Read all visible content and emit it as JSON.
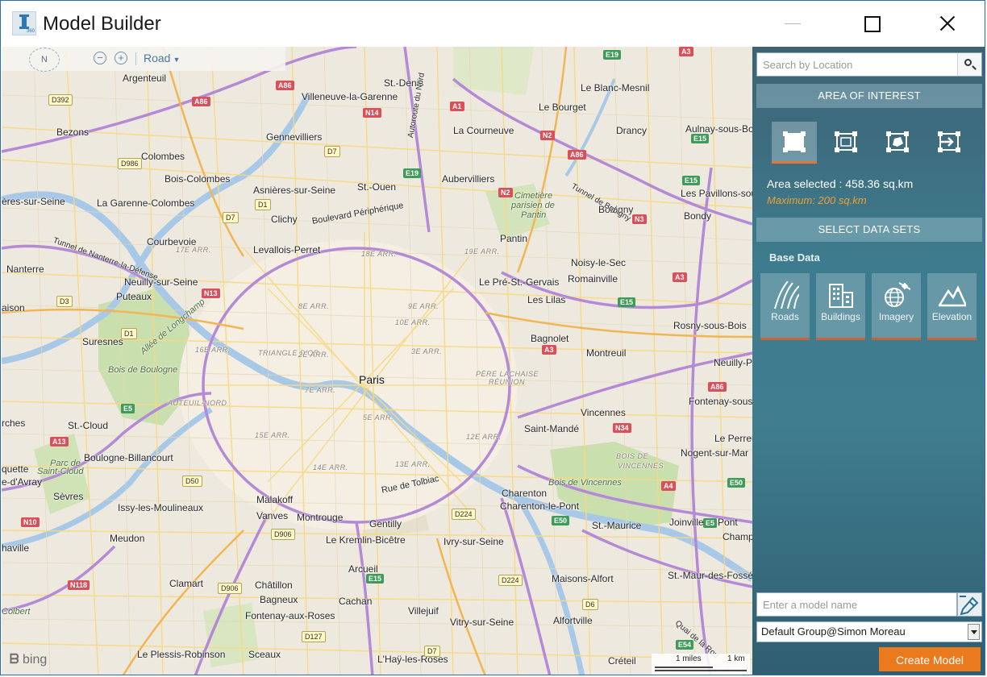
{
  "window": {
    "title": "Model Builder",
    "logo_sub": "360"
  },
  "map_toolbar": {
    "compass_label": "N",
    "zoom_out": "−",
    "zoom_in": "+",
    "map_style": "Road"
  },
  "map": {
    "labels": [
      {
        "text": "Paris",
        "cls": "big"
      },
      {
        "text": "Argenteuil"
      },
      {
        "text": "St.-Denis"
      },
      {
        "text": "Le Blanc-Mesnil"
      },
      {
        "text": "Villeneuve-la-Garenne"
      },
      {
        "text": "Le Bourget"
      },
      {
        "text": "Bezons"
      },
      {
        "text": "Gennevilliers"
      },
      {
        "text": "La Courneuve"
      },
      {
        "text": "Drancy"
      },
      {
        "text": "Aulnay-sous-Bo"
      },
      {
        "text": "Colombes"
      },
      {
        "text": "Bois-Colombes"
      },
      {
        "text": "Aubervilliers"
      },
      {
        "text": "Asnières-sur-Seine"
      },
      {
        "text": "St.-Ouen"
      },
      {
        "text": "Bobigny"
      },
      {
        "text": "Les Pavillons-sou"
      },
      {
        "text": "La Garenne-Colombes"
      },
      {
        "text": "ères-sur-Seine"
      },
      {
        "text": "Clichy"
      },
      {
        "text": "Bondy"
      },
      {
        "text": "Courbevoie"
      },
      {
        "text": "Levallois-Perret"
      },
      {
        "text": "Pantin"
      },
      {
        "text": "Noisy-le-Sec"
      },
      {
        "text": "Nanterre"
      },
      {
        "text": "Neuilly-sur-Seine"
      },
      {
        "text": "Le Pré-St.-Gervais"
      },
      {
        "text": "Romainville"
      },
      {
        "text": "Puteaux"
      },
      {
        "text": "Les Lilas"
      },
      {
        "text": "aison"
      },
      {
        "text": "Suresnes"
      },
      {
        "text": "Bagnolet"
      },
      {
        "text": "Rosny-sous-Bois"
      },
      {
        "text": "Montreuil"
      },
      {
        "text": "Neuilly-Pl"
      },
      {
        "text": "Fontenay-sous"
      },
      {
        "text": "rches"
      },
      {
        "text": "St.-Cloud"
      },
      {
        "text": "Vincennes"
      },
      {
        "text": "Saint-Mandé"
      },
      {
        "text": "Le Perreu"
      },
      {
        "text": "Nogent-sur-Mar"
      },
      {
        "text": "Boulogne-Billancourt"
      },
      {
        "text": "quette"
      },
      {
        "text": "e-d'Avray"
      },
      {
        "text": "Sèvres"
      },
      {
        "text": "Issy-les-Moulineaux"
      },
      {
        "text": "Malakoff"
      },
      {
        "text": "Charenton"
      },
      {
        "text": "Charenton-le-Pont"
      },
      {
        "text": "Vanves"
      },
      {
        "text": "Montrouge"
      },
      {
        "text": "Gentilly"
      },
      {
        "text": "Joinville-le-Pont"
      },
      {
        "text": "Meudon"
      },
      {
        "text": "Le Kremlin-Bicêtre"
      },
      {
        "text": "Ivry-sur-Seine"
      },
      {
        "text": "St.-Maurice"
      },
      {
        "text": "Champ"
      },
      {
        "text": "haville"
      },
      {
        "text": "Arcueil"
      },
      {
        "text": "Clamart"
      },
      {
        "text": "Maisons-Alfort"
      },
      {
        "text": "St.-Maur-des-Fossé"
      },
      {
        "text": "Châtillon"
      },
      {
        "text": "Bagneux"
      },
      {
        "text": "Cachan"
      },
      {
        "text": "Villejuif"
      },
      {
        "text": "Fontenay-aux-Roses"
      },
      {
        "text": "Alfortville"
      },
      {
        "text": "Vitry-sur-Seine"
      },
      {
        "text": "Le Plessis-Robinson"
      },
      {
        "text": "Sceaux"
      },
      {
        "text": "L'Haÿ-les-Roses"
      },
      {
        "text": "Créteil"
      },
      {
        "text": "18E ARR.",
        "cls": "district"
      },
      {
        "text": "17E ARR.",
        "cls": "district"
      },
      {
        "text": "19E ARR.",
        "cls": "district"
      },
      {
        "text": "8E ARR.",
        "cls": "district"
      },
      {
        "text": "9E ARR.",
        "cls": "district"
      },
      {
        "text": "10E ARR.",
        "cls": "district"
      },
      {
        "text": "16E ARR.",
        "cls": "district"
      },
      {
        "text": "TRIANGLE D'OR",
        "cls": "district"
      },
      {
        "text": "3E ARR.",
        "cls": "district"
      },
      {
        "text": "2E ARR.",
        "cls": "district"
      },
      {
        "text": "7E ARR.",
        "cls": "district"
      },
      {
        "text": "AUTEUIL-NORD",
        "cls": "district"
      },
      {
        "text": "PÈRE LACHAISE",
        "cls": "district"
      },
      {
        "text": "RÉUNION",
        "cls": "district"
      },
      {
        "text": "5E ARR.",
        "cls": "district"
      },
      {
        "text": "15E ARR.",
        "cls": "district"
      },
      {
        "text": "12E ARR.",
        "cls": "district"
      },
      {
        "text": "14E ARR.",
        "cls": "district"
      },
      {
        "text": "13E ARR.",
        "cls": "district"
      },
      {
        "text": "BOIS DE",
        "cls": "district"
      },
      {
        "text": "VINCENNES",
        "cls": "district"
      },
      {
        "text": "Bois de Boulogne",
        "cls": "park"
      },
      {
        "text": "Allée de Longchamp",
        "cls": "park"
      },
      {
        "text": "Bois de Vincennes",
        "cls": "park"
      },
      {
        "text": "Cimetière",
        "cls": "park"
      },
      {
        "text": "parisien de",
        "cls": "park"
      },
      {
        "text": "Pantin",
        "cls": "park"
      },
      {
        "text": "Parc de",
        "cls": "park"
      },
      {
        "text": "Saint-Cloud",
        "cls": "park"
      },
      {
        "text": "Colbert",
        "cls": "park"
      },
      {
        "text": "Boulevard Périphérique"
      },
      {
        "text": "Rue de Tolbiac"
      },
      {
        "text": "Tunnel de Nanterre-la-Défense"
      },
      {
        "text": "Autoroute du Nord"
      },
      {
        "text": "Tunnel de Bobigny"
      },
      {
        "text": "Quai de la Rou"
      }
    ],
    "shields": [
      {
        "text": "A86"
      },
      {
        "text": "A86"
      },
      {
        "text": "A1"
      },
      {
        "text": "N14"
      },
      {
        "text": "N2"
      },
      {
        "text": "A86"
      },
      {
        "text": "N2"
      },
      {
        "text": "N3"
      },
      {
        "text": "N13"
      },
      {
        "text": "A3"
      },
      {
        "text": "A3"
      },
      {
        "text": "N34"
      },
      {
        "text": "A86"
      },
      {
        "text": "A13"
      },
      {
        "text": "A4"
      },
      {
        "text": "N10"
      },
      {
        "text": "N118"
      },
      {
        "text": "A3"
      },
      {
        "text": "E19",
        "cls": "e"
      },
      {
        "text": "E15",
        "cls": "e"
      },
      {
        "text": "E15",
        "cls": "e"
      },
      {
        "text": "E19",
        "cls": "e"
      },
      {
        "text": "E15",
        "cls": "e"
      },
      {
        "text": "E5",
        "cls": "e"
      },
      {
        "text": "E50",
        "cls": "e"
      },
      {
        "text": "E15",
        "cls": "e"
      },
      {
        "text": "E54",
        "cls": "e"
      },
      {
        "text": "E5",
        "cls": "e"
      },
      {
        "text": "E50",
        "cls": "e"
      },
      {
        "text": "D392",
        "cls": "d"
      },
      {
        "text": "D986",
        "cls": "d"
      },
      {
        "text": "D7",
        "cls": "d"
      },
      {
        "text": "D1",
        "cls": "d"
      },
      {
        "text": "D7",
        "cls": "d"
      },
      {
        "text": "D3",
        "cls": "d"
      },
      {
        "text": "D1",
        "cls": "d"
      },
      {
        "text": "D50",
        "cls": "d"
      },
      {
        "text": "D906",
        "cls": "d"
      },
      {
        "text": "D224",
        "cls": "d"
      },
      {
        "text": "D906",
        "cls": "d"
      },
      {
        "text": "D224",
        "cls": "d"
      },
      {
        "text": "D6",
        "cls": "d"
      },
      {
        "text": "D127",
        "cls": "d"
      },
      {
        "text": "D7",
        "cls": "d"
      }
    ],
    "bing_logo": "bing",
    "scale_miles": "1 miles",
    "scale_km": "1 km"
  },
  "panel": {
    "search_placeholder": "Search by Location",
    "aoi_header": "AREA OF INTEREST",
    "area_selected": "Area selected : 458.36 sq.km",
    "area_max": "Maximum: 200 sq.km",
    "datasets_header": "SELECT DATA SETS",
    "base_data_label": "Base Data",
    "datasets": [
      {
        "label": "Roads",
        "icon": "roads-icon"
      },
      {
        "label": "Buildings",
        "icon": "buildings-icon"
      },
      {
        "label": "Imagery",
        "icon": "satellite-globe-icon"
      },
      {
        "label": "Elevation",
        "icon": "mountain-icon"
      }
    ],
    "model_name_placeholder": "Enter a model name",
    "group_value": "Default Group@Simon Moreau",
    "create_button": "Create Model"
  },
  "colors": {
    "panel_top": "#3d6274",
    "panel_mid": "#3f7d8f",
    "accent": "#ea7a1d",
    "warning": "#f0a030",
    "map_bg": "#eee9de"
  }
}
